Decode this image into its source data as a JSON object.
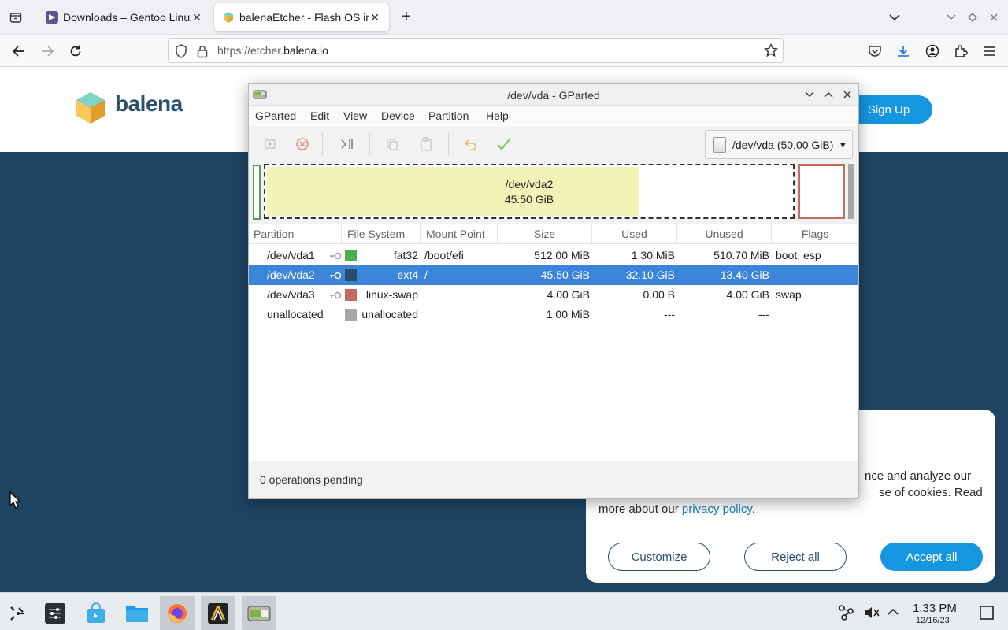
{
  "browser": {
    "tabs": [
      {
        "title": "Downloads – Gentoo Linux",
        "active": false
      },
      {
        "title": "balenaEtcher - Flash OS images",
        "active": true
      }
    ],
    "url_prefix": "https://etcher.",
    "url_domain": "balena.io"
  },
  "website": {
    "brand": "balena",
    "signup_label": "Sign Up",
    "cookie": {
      "text_line1": "nce and analyze our",
      "text_line2": "se of cookies. Read",
      "text_line3_prefix": "more about our ",
      "privacy_link": "privacy policy",
      "text_line3_suffix": ".",
      "customize_label": "Customize",
      "reject_label": "Reject all",
      "accept_label": "Accept all"
    }
  },
  "gparted": {
    "title": "/dev/vda - GParted",
    "menu": [
      "GParted",
      "Edit",
      "View",
      "Device",
      "Partition",
      "Help"
    ],
    "device_selector": "/dev/vda (50.00 GiB)",
    "graph": {
      "label_name": "/dev/vda2",
      "label_size": "45.50 GiB",
      "used_fraction": 0.7055
    },
    "columns": [
      "Partition",
      "File System",
      "Mount Point",
      "Size",
      "Used",
      "Unused",
      "Flags"
    ],
    "rows": [
      {
        "partition": "/dev/vda1",
        "fs": "fat32",
        "mount": "/boot/efi",
        "size": "512.00 MiB",
        "used": "1.30 MiB",
        "unused": "510.70 MiB",
        "flags": "boot, esp",
        "color": "#4caf50",
        "key": true,
        "selected": false
      },
      {
        "partition": "/dev/vda2",
        "fs": "ext4",
        "mount": "/",
        "size": "45.50 GiB",
        "used": "32.10 GiB",
        "unused": "13.40 GiB",
        "flags": "",
        "color": "#2c4a70",
        "key": true,
        "selected": true
      },
      {
        "partition": "/dev/vda3",
        "fs": "linux-swap",
        "mount": "",
        "size": "4.00 GiB",
        "used": "0.00 B",
        "unused": "4.00 GiB",
        "flags": "swap",
        "color": "#c46a5e",
        "key": true,
        "selected": false
      },
      {
        "partition": "unallocated",
        "fs": "unallocated",
        "mount": "",
        "size": "1.00 MiB",
        "used": "---",
        "unused": "---",
        "flags": "",
        "color": "#a8a8a8",
        "key": false,
        "selected": false
      }
    ],
    "status": "0 operations pending"
  },
  "taskbar": {
    "time": "1:33 PM",
    "date": "12/16/23"
  }
}
